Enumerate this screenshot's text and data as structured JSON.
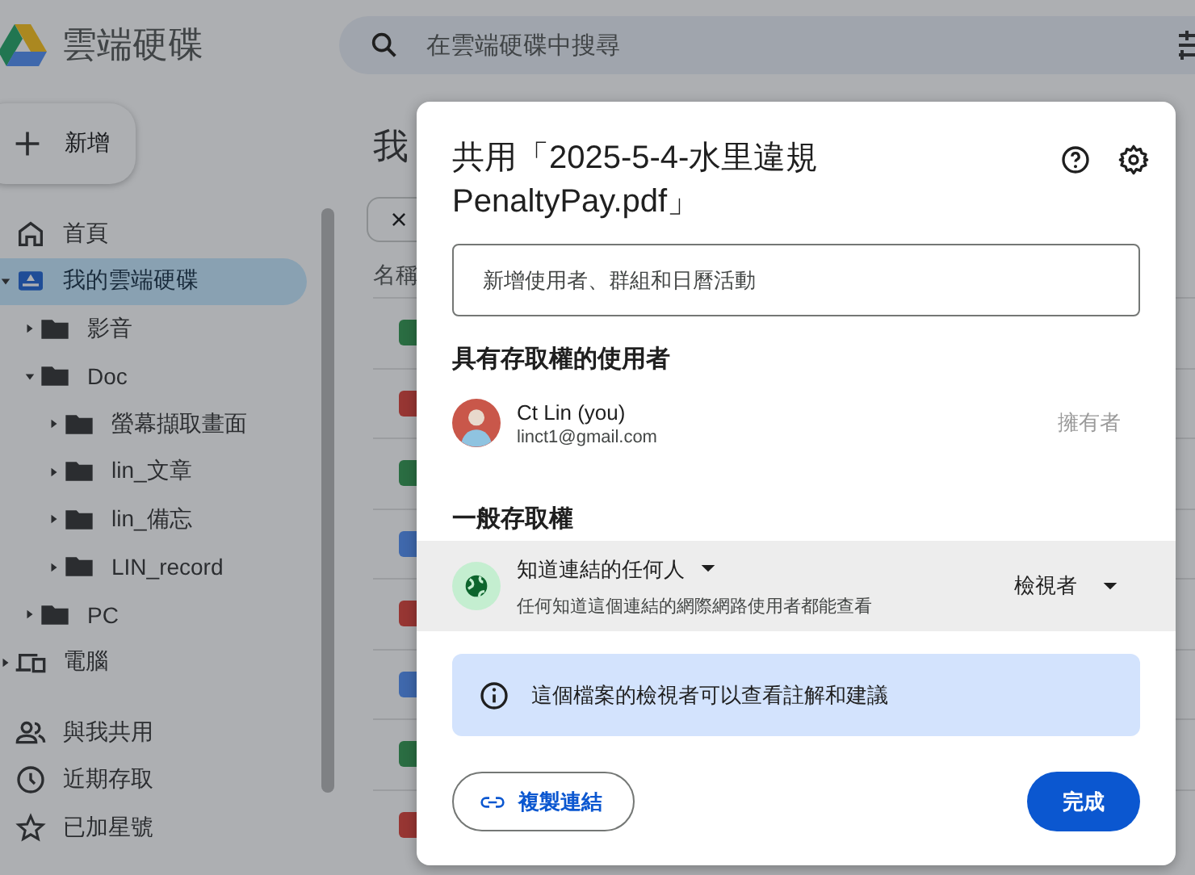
{
  "app": {
    "title": "雲端硬碟",
    "search_placeholder": "在雲端硬碟中搜尋",
    "new_button": "新增"
  },
  "sidebar": {
    "items": [
      {
        "label": "首頁",
        "kind": "home",
        "selected": false
      },
      {
        "label": "我的雲端硬碟",
        "kind": "drive",
        "selected": true,
        "expanded": true,
        "children": [
          {
            "label": "影音",
            "kind": "folder",
            "selected": false,
            "expanded": false
          },
          {
            "label": "Doc",
            "kind": "folder",
            "selected": false,
            "expanded": true,
            "children": [
              {
                "label": "螢幕擷取畫面",
                "kind": "folder",
                "selected": false,
                "expanded": false
              },
              {
                "label": "lin_文章",
                "kind": "folder",
                "selected": false,
                "expanded": false
              },
              {
                "label": "lin_備忘",
                "kind": "folder",
                "selected": false,
                "expanded": false
              },
              {
                "label": "LIN_record",
                "kind": "folder",
                "selected": false,
                "expanded": false
              }
            ]
          },
          {
            "label": "PC",
            "kind": "folder",
            "selected": false,
            "expanded": false
          }
        ]
      },
      {
        "label": "電腦",
        "kind": "computer",
        "selected": false,
        "expanded": false
      }
    ],
    "secondary": [
      {
        "label": "與我共用",
        "kind": "shared",
        "selected": false
      },
      {
        "label": "近期存取",
        "kind": "recent",
        "selected": false
      },
      {
        "label": "已加星號",
        "kind": "starred",
        "selected": false
      }
    ]
  },
  "main": {
    "heading": "我",
    "chip": "×",
    "column_1": "名稱",
    "rows": [
      {
        "kind": "sheet"
      },
      {
        "kind": "pdf"
      },
      {
        "kind": "sheet"
      },
      {
        "kind": "doc"
      },
      {
        "kind": "pdf"
      },
      {
        "kind": "doc"
      },
      {
        "kind": "sheet"
      },
      {
        "kind": "pdf"
      }
    ]
  },
  "dialog": {
    "title": "共用「2025-5-4-水里違規 PenaltyPay.pdf」",
    "add_placeholder": "新增使用者、群組和日曆活動",
    "people_heading": "具有存取權的使用者",
    "people": [
      {
        "name": "Ct Lin (you)",
        "email": "linct1@gmail.com",
        "role": "擁有者"
      }
    ],
    "general_heading": "一般存取權",
    "general_access": {
      "label": "知道連結的任何人",
      "description": "任何知道這個連結的網際網路使用者都能查看",
      "role": "檢視者"
    },
    "info": "這個檔案的檢視者可以查看註解和建議",
    "copy_link": "複製連結",
    "done": "完成"
  }
}
